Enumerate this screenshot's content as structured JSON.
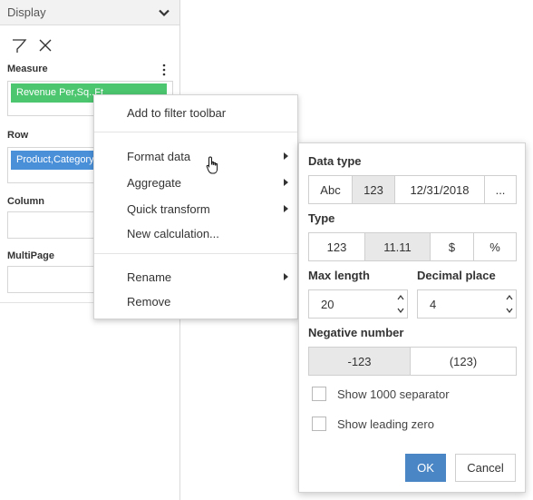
{
  "panel": {
    "title": "Display",
    "sections": {
      "measure": {
        "label": "Measure",
        "pill": "Revenue Per,Sq..Ft"
      },
      "row": {
        "label": "Row",
        "pill": "Product,Category"
      },
      "column": {
        "label": "Column"
      },
      "multipage": {
        "label": "MultiPage"
      }
    },
    "icons": [
      "chevron-down-icon",
      "funnel-icon",
      "close-icon",
      "kebab-icon"
    ],
    "colors": {
      "measure_pill": "#4cc66f",
      "row_pill": "#4a90d9"
    }
  },
  "context_menu": {
    "items": [
      {
        "label": "Add to filter toolbar"
      },
      {
        "label": "Format data",
        "submenu": true
      },
      {
        "label": "Aggregate",
        "submenu": true
      },
      {
        "label": "Quick transform",
        "submenu": true
      },
      {
        "label": "New calculation..."
      },
      {
        "label": "Rename",
        "submenu": true
      },
      {
        "label": "Remove"
      }
    ]
  },
  "format_data": {
    "data_type": {
      "label": "Data type",
      "options": [
        "Abc",
        "123",
        "12/31/2018",
        "..."
      ],
      "selected": "123"
    },
    "type": {
      "label": "Type",
      "options": [
        "123",
        "11.11",
        "$",
        "%"
      ],
      "selected": "11.11"
    },
    "max_length": {
      "label": "Max length",
      "value": "20"
    },
    "decimal_place": {
      "label": "Decimal place",
      "value": "4"
    },
    "negative_number": {
      "label": "Negative number",
      "options": [
        "-123",
        "(123)"
      ],
      "selected": "-123"
    },
    "show_1000_separator": {
      "label": "Show 1000 separator",
      "checked": false
    },
    "show_leading_zero": {
      "label": "Show leading zero",
      "checked": false
    },
    "ok_label": "OK",
    "cancel_label": "Cancel",
    "colors": {
      "ok_button": "#4a86c5",
      "selected_segment": "#e8e8e8"
    }
  }
}
